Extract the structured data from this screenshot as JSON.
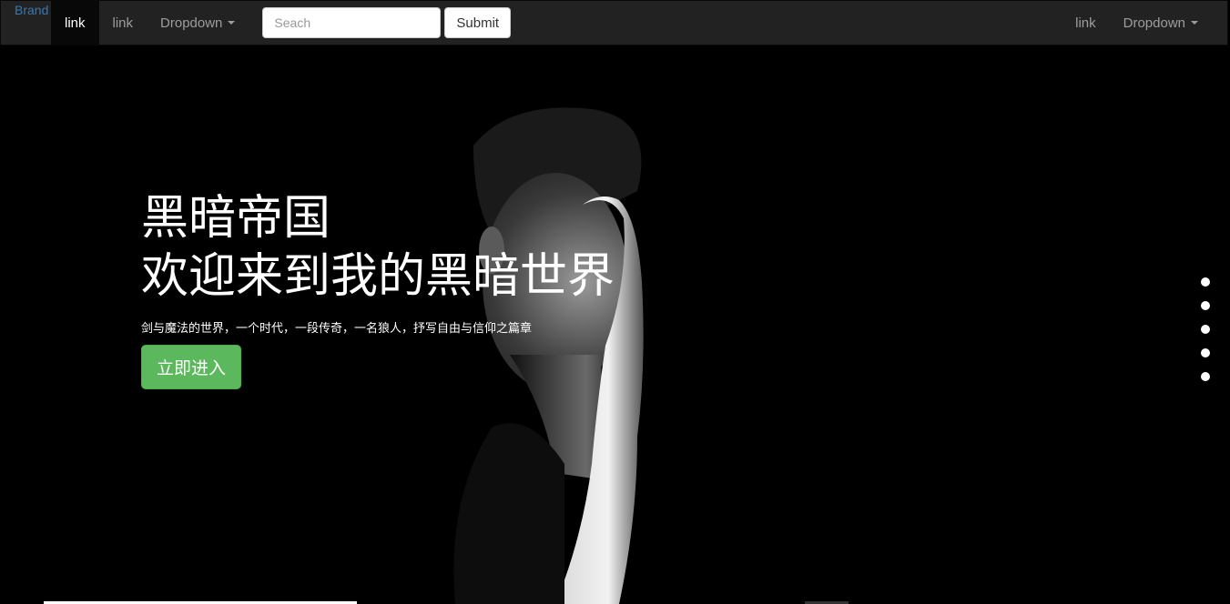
{
  "navbar": {
    "brand": "Brand",
    "left_items": [
      {
        "label": "link",
        "active": true
      },
      {
        "label": "link",
        "active": false
      },
      {
        "label": "Dropdown",
        "dropdown": true
      }
    ],
    "search": {
      "placeholder": "Seach",
      "value": ""
    },
    "submit_label": "Submit",
    "right_items": [
      {
        "label": "link"
      },
      {
        "label": "Dropdown",
        "dropdown": true
      }
    ]
  },
  "hero": {
    "title": "黑暗帝国",
    "subtitle": "欢迎来到我的黑暗世界",
    "description": "剑与魔法的世界，一个时代，一段传奇，一名狼人，抒写自由与信仰之篇章",
    "button_label": "立即进入"
  },
  "carousel": {
    "dot_count": 5,
    "active_index": 0
  },
  "colors": {
    "navbar_bg": "#222222",
    "brand": "#337ab7",
    "button_green": "#5cb85c",
    "hero_bg": "#000000"
  }
}
